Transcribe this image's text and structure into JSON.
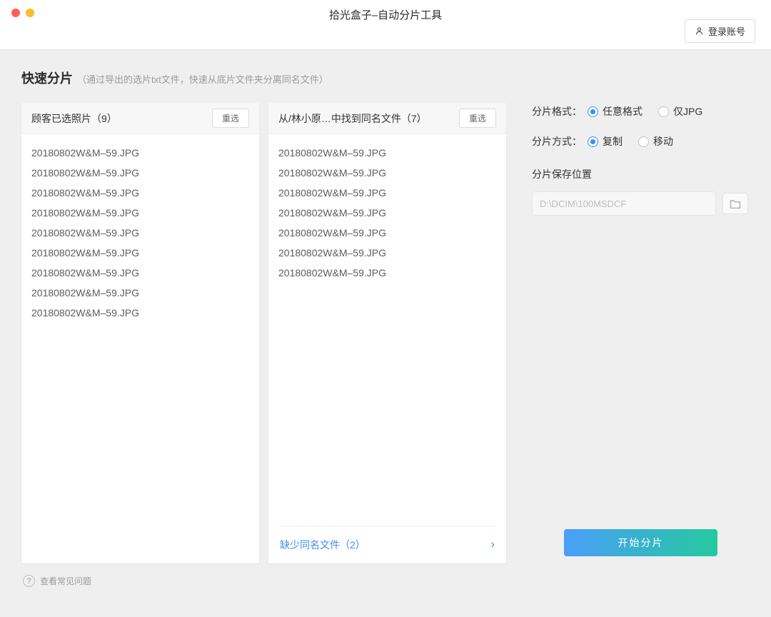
{
  "window": {
    "title": "拾光盒子–自动分片工具",
    "login_label": "登录账号"
  },
  "header": {
    "title": "快速分片",
    "subtitle": "（通过导出的选片txt文件，快速从底片文件夹分离同名文件）"
  },
  "selected_panel": {
    "title": "顾客已选照片（9）",
    "reselect_label": "重选",
    "files": [
      "20180802W&M–59.JPG",
      "20180802W&M–59.JPG",
      "20180802W&M–59.JPG",
      "20180802W&M–59.JPG",
      "20180802W&M–59.JPG",
      "20180802W&M–59.JPG",
      "20180802W&M–59.JPG",
      "20180802W&M–59.JPG",
      "20180802W&M–59.JPG"
    ]
  },
  "matched_panel": {
    "title": "从/林小原…中找到同名文件（7）",
    "reselect_label": "重选",
    "files": [
      "20180802W&M–59.JPG",
      "20180802W&M–59.JPG",
      "20180802W&M–59.JPG",
      "20180802W&M–59.JPG",
      "20180802W&M–59.JPG",
      "20180802W&M–59.JPG",
      "20180802W&M–59.JPG"
    ],
    "missing_link": "缺少同名文件（2）",
    "chevron_icon": "›"
  },
  "options": {
    "format_label": "分片格式：",
    "format_options": [
      {
        "label": "任意格式",
        "selected": true
      },
      {
        "label": "仅JPG",
        "selected": false
      }
    ],
    "mode_label": "分片方式：",
    "mode_options": [
      {
        "label": "复制",
        "selected": true
      },
      {
        "label": "移动",
        "selected": false
      }
    ],
    "save_location_label": "分片保存位置",
    "save_path_placeholder": "D:\\DCIM\\100MSDCF",
    "start_label": "开始分片"
  },
  "footer": {
    "help_icon": "?",
    "faq_label": "查看常见问题"
  }
}
